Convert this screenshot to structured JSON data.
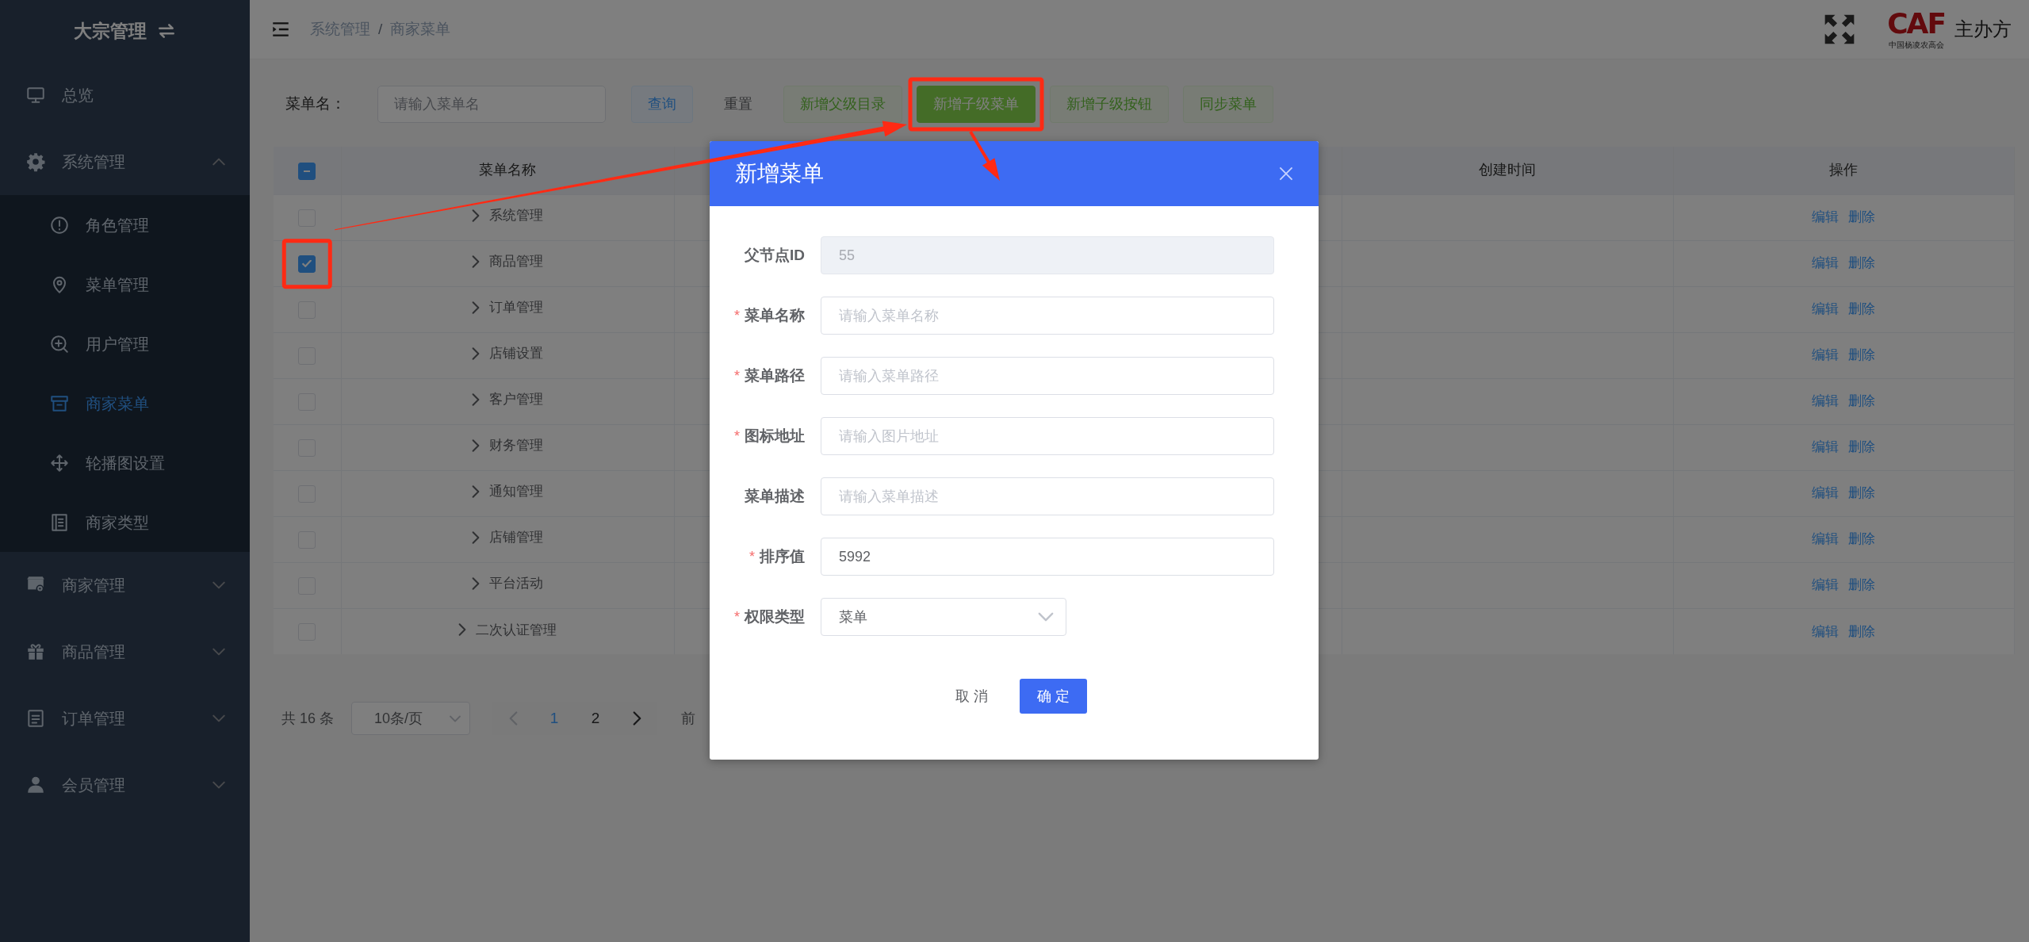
{
  "sidebar": {
    "title": "大宗管理",
    "items": [
      {
        "label": "总览",
        "kind": "link",
        "selected": false
      },
      {
        "label": "系统管理",
        "kind": "group",
        "selected": false,
        "expanded": true,
        "children": [
          {
            "label": "角色管理",
            "selected": false
          },
          {
            "label": "菜单管理",
            "selected": false
          },
          {
            "label": "用户管理",
            "selected": false
          },
          {
            "label": "商家菜单",
            "selected": true
          },
          {
            "label": "轮播图设置",
            "selected": false
          },
          {
            "label": "商家类型",
            "selected": false
          }
        ]
      },
      {
        "label": "商家管理",
        "kind": "group",
        "selected": false,
        "expanded": false
      },
      {
        "label": "商品管理",
        "kind": "group",
        "selected": false,
        "expanded": false
      },
      {
        "label": "订单管理",
        "kind": "group",
        "selected": false,
        "expanded": false
      },
      {
        "label": "会员管理",
        "kind": "group",
        "selected": false,
        "expanded": false
      }
    ]
  },
  "header": {
    "breadcrumb": [
      "系统管理",
      "商家菜单"
    ],
    "breadcrumb_separator": "/",
    "logo_text": "CAF",
    "logo_subtitle": "中国杨凌农高会",
    "organizer": "主办方"
  },
  "toolbar": {
    "filter_label": "菜单名：",
    "placeholder": "请输入菜单名",
    "buttons": [
      {
        "label": "查询",
        "kind": "primary-plain",
        "highlighted": false
      },
      {
        "label": "重置",
        "kind": "default",
        "highlighted": false
      },
      {
        "label": "新增父级目录",
        "kind": "success-plain",
        "highlighted": false
      },
      {
        "label": "新增子级菜单",
        "kind": "success",
        "highlighted": true
      },
      {
        "label": "新增子级按钮",
        "kind": "success-plain",
        "highlighted": false
      },
      {
        "label": "同步菜单",
        "kind": "success-plain",
        "highlighted": false
      }
    ]
  },
  "table": {
    "header_checkbox": {
      "indeterminate": true
    },
    "columns": {
      "name": "菜单名称",
      "created_at": "创建时间",
      "actions": "操作"
    },
    "rows": [
      {
        "name": "系统管理",
        "checked": false,
        "expanded": false,
        "highlighted": false,
        "actions": [
          "编辑",
          "删除"
        ]
      },
      {
        "name": "商品管理",
        "checked": true,
        "expanded": false,
        "highlighted": true,
        "actions": [
          "编辑",
          "删除"
        ]
      },
      {
        "name": "订单管理",
        "checked": false,
        "expanded": false,
        "highlighted": false,
        "actions": [
          "编辑",
          "删除"
        ]
      },
      {
        "name": "店铺设置",
        "checked": false,
        "expanded": false,
        "highlighted": false,
        "actions": [
          "编辑",
          "删除"
        ]
      },
      {
        "name": "客户管理",
        "checked": false,
        "expanded": false,
        "highlighted": false,
        "actions": [
          "编辑",
          "删除"
        ]
      },
      {
        "name": "财务管理",
        "checked": false,
        "expanded": false,
        "highlighted": false,
        "actions": [
          "编辑",
          "删除"
        ]
      },
      {
        "name": "通知管理",
        "checked": false,
        "expanded": false,
        "highlighted": false,
        "actions": [
          "编辑",
          "删除"
        ]
      },
      {
        "name": "店铺管理",
        "checked": false,
        "expanded": false,
        "highlighted": false,
        "actions": [
          "编辑",
          "删除"
        ]
      },
      {
        "name": "平台活动",
        "checked": false,
        "expanded": false,
        "highlighted": false,
        "actions": [
          "编辑",
          "删除"
        ]
      },
      {
        "name": "二次认证管理",
        "checked": false,
        "expanded": false,
        "highlighted": false,
        "actions": [
          "编辑",
          "删除"
        ]
      }
    ]
  },
  "pagination": {
    "total": "共 16 条",
    "page_size": "10条/页",
    "prev_disabled": true,
    "next_disabled": false,
    "pages": [
      {
        "label": "1",
        "selected": true
      },
      {
        "label": "2",
        "selected": false
      }
    ],
    "jump_label": "前"
  },
  "dialog": {
    "title": "新增菜单",
    "required_mark": "*",
    "fields": [
      {
        "kind": "input",
        "label": "父节点ID",
        "required": false,
        "disabled": true,
        "value": "55"
      },
      {
        "kind": "input",
        "label": "菜单名称",
        "required": true,
        "disabled": false,
        "placeholder": "请输入菜单名称"
      },
      {
        "kind": "input",
        "label": "菜单路径",
        "required": true,
        "disabled": false,
        "placeholder": "请输入菜单路径"
      },
      {
        "kind": "input",
        "label": "图标地址",
        "required": true,
        "disabled": false,
        "placeholder": "请输入图片地址"
      },
      {
        "kind": "input",
        "label": "菜单描述",
        "required": false,
        "disabled": false,
        "placeholder": "请输入菜单描述"
      },
      {
        "kind": "input",
        "label": "排序值",
        "required": true,
        "disabled": false,
        "value": "5992"
      },
      {
        "kind": "select",
        "label": "权限类型",
        "required": true,
        "disabled": false,
        "value": "菜单"
      }
    ],
    "cancel": "取 消",
    "confirm": "确 定"
  }
}
